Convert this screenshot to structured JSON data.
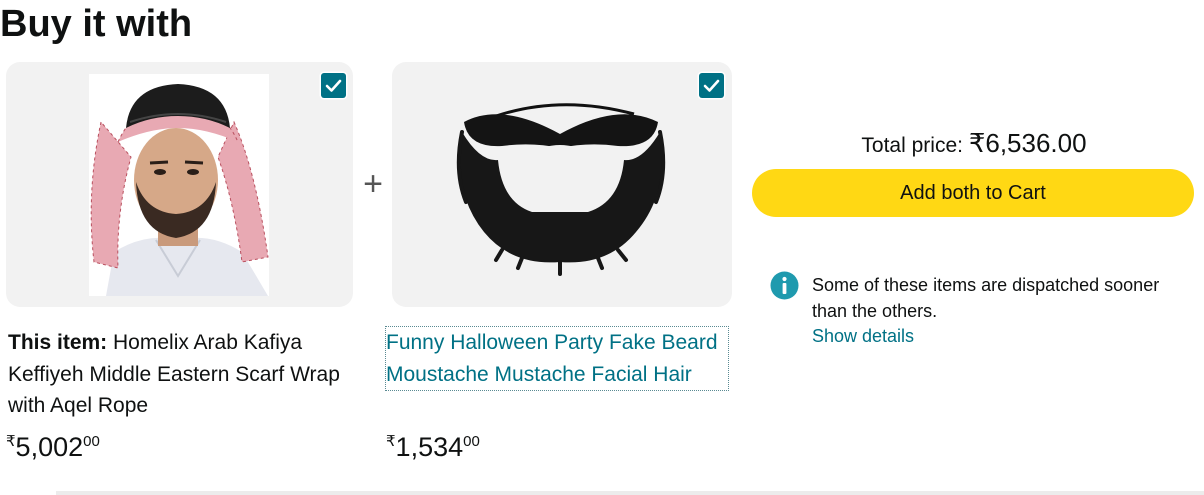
{
  "section": {
    "heading": "Buy it with"
  },
  "items": [
    {
      "checked": true,
      "title_prefix": "This item: ",
      "title": "Homelix Arab Kafiya Keffiyeh Middle Eastern Scarf Wrap with Aqel Rope",
      "price_symbol": "₹",
      "price_whole": "5,002",
      "price_fraction": "00"
    },
    {
      "checked": true,
      "title": "Funny Halloween Party Fake Beard Moustache Mustache Facial Hair",
      "price_symbol": "₹",
      "price_whole": "1,534",
      "price_fraction": "00"
    }
  ],
  "plus_sign": "+",
  "total": {
    "label": "Total price: ",
    "amount": "₹6,536.00"
  },
  "cart_button": {
    "label": "Add both to Cart"
  },
  "notice": {
    "text": "Some of these items are dispatched sooner than the others.",
    "link": "Show details"
  },
  "colors": {
    "accent": "#007185",
    "button": "#ffd814",
    "card_bg": "#f2f2f2",
    "text": "#0f1111"
  },
  "icons": {
    "checkbox": "checkmark-icon",
    "info": "info-icon"
  }
}
